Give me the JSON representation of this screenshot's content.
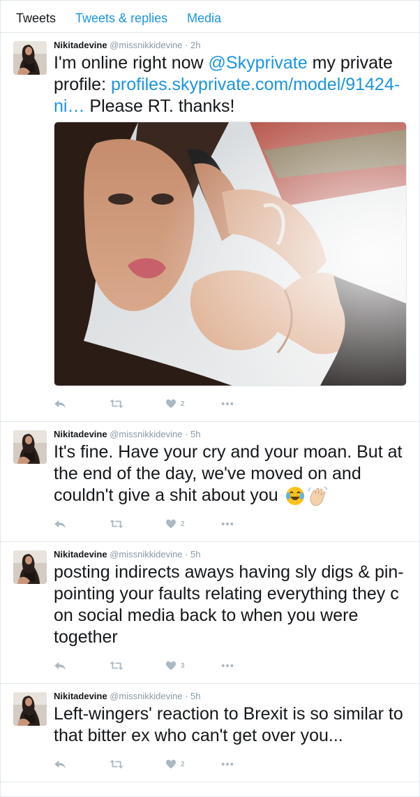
{
  "tabs": [
    {
      "label": "Tweets",
      "active": true
    },
    {
      "label": "Tweets & replies",
      "active": false
    },
    {
      "label": "Media",
      "active": false
    }
  ],
  "tweets": [
    {
      "name": "Nikitadevine",
      "handle": "@missnikkidevine",
      "dot": "·",
      "time": "2h",
      "text_before": "I'm online right now ",
      "mention": "@Skyprivate",
      "text_middle": " my private profile: ",
      "url": "profiles.skyprivate.com/model/91424-ni…",
      "text_after": " Please RT. thanks!",
      "likes": "2"
    },
    {
      "name": "Nikitadevine",
      "handle": "@missnikkidevine",
      "dot": "·",
      "time": "5h",
      "text": "It's fine. Have your cry and your moan. But at the end of the day, we've moved on and couldn't give a shit about you",
      "likes": "2"
    },
    {
      "name": "Nikitadevine",
      "handle": "@missnikkidevine",
      "dot": "·",
      "time": "5h",
      "text": "posting indirects aways having sly digs & pin-pointing your faults relating everything they c on social media back to when you were together",
      "likes": "3"
    },
    {
      "name": "Nikitadevine",
      "handle": "@missnikkidevine",
      "dot": "·",
      "time": "5h",
      "text": "Left-wingers' reaction to Brexit is so similar to that bitter ex who can't get over you...",
      "likes": "2"
    }
  ],
  "colors": {
    "link": "#1b95e0",
    "text": "#14171a",
    "muted": "#8899a6",
    "action": "#aab8c2",
    "border": "#e1e8ed"
  },
  "icons": [
    "reply-icon",
    "retweet-icon",
    "heart-icon",
    "more-icon",
    "tears-of-joy-emoji-icon",
    "waving-hand-emoji-icon"
  ]
}
